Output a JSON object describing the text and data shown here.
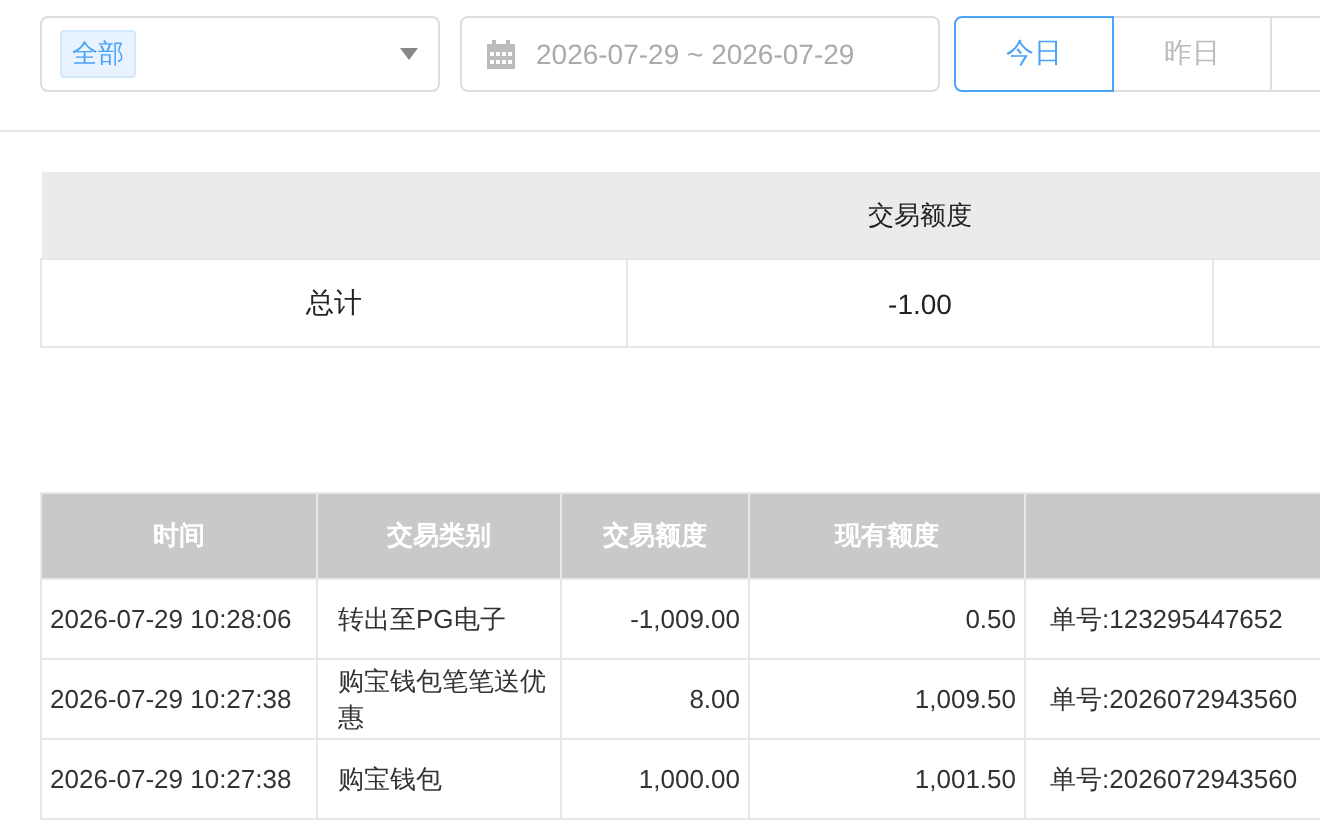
{
  "filter": {
    "select": {
      "tag": "全部"
    },
    "date_range": {
      "value": "2026-07-29 ~ 2026-07-29"
    },
    "quick_buttons": [
      {
        "label": "今日",
        "selected": true
      },
      {
        "label": "昨日",
        "selected": false
      },
      {
        "selected": false
      }
    ]
  },
  "summary": {
    "columns": [
      "",
      "交易额度",
      ""
    ],
    "rows": [
      [
        "总计",
        "-1.00",
        ""
      ]
    ]
  },
  "table": {
    "columns": [
      "时间",
      "交易类别",
      "交易额度",
      "现有额度",
      ""
    ],
    "rows": [
      [
        "2026-07-29 10:28:06",
        "转出至PG电子",
        "-1,009.00",
        "0.50",
        "单号:123295447652"
      ],
      [
        "2026-07-29 10:27:38",
        "购宝钱包笔笔送优惠",
        "8.00",
        "1,009.50",
        "单号:2026072943560"
      ],
      [
        "2026-07-29 10:27:38",
        "购宝钱包",
        "1,000.00",
        "1,001.50",
        "单号:2026072943560"
      ]
    ]
  }
}
